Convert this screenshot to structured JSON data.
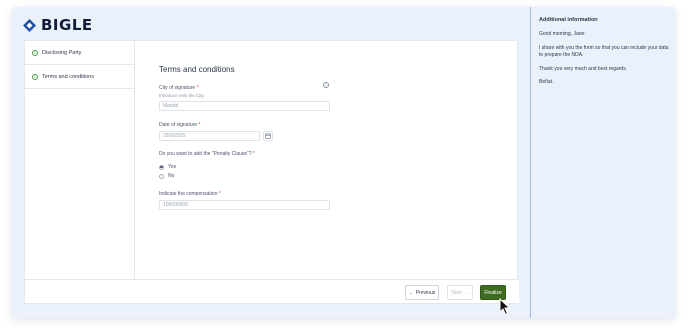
{
  "brand": {
    "name": "BIGLE",
    "mark_color": "#1f4fa3"
  },
  "steps": [
    {
      "label": "Disclosing Party",
      "status": "completed"
    },
    {
      "label": "Terms and conditions",
      "status": "completed"
    }
  ],
  "form": {
    "title": "Terms and conditions",
    "city": {
      "label": "City of signature",
      "required_mark": "*",
      "hint": "Introduce only the City.",
      "value": "Madrid",
      "help_icon": "question-circle-icon"
    },
    "date": {
      "label": "Date of signature",
      "required_mark": "*",
      "value": "29/9/2025",
      "calendar_icon": "calendar-icon"
    },
    "penalty": {
      "label": "Do you want to add the \"Penalty Clause\"?",
      "required_mark": "*",
      "options": [
        {
          "label": "Yes",
          "selected": true
        },
        {
          "label": "No",
          "selected": false
        }
      ]
    },
    "compensation": {
      "label": "Indicate the compensation",
      "required_mark": "*",
      "value": "100000000"
    }
  },
  "footer": {
    "previous_label": "Previous",
    "next_label": "Next",
    "finalize_label": "Finalize",
    "finalize_color": "#3d6b1f"
  },
  "sidebar": {
    "title": "Additional information",
    "greeting": "Good morning, Jane:",
    "body": "I share with you the form so that you can include your data to prepare the NDA.",
    "thanks": "Thank you very much and best regards.",
    "signature": "Beñat."
  }
}
